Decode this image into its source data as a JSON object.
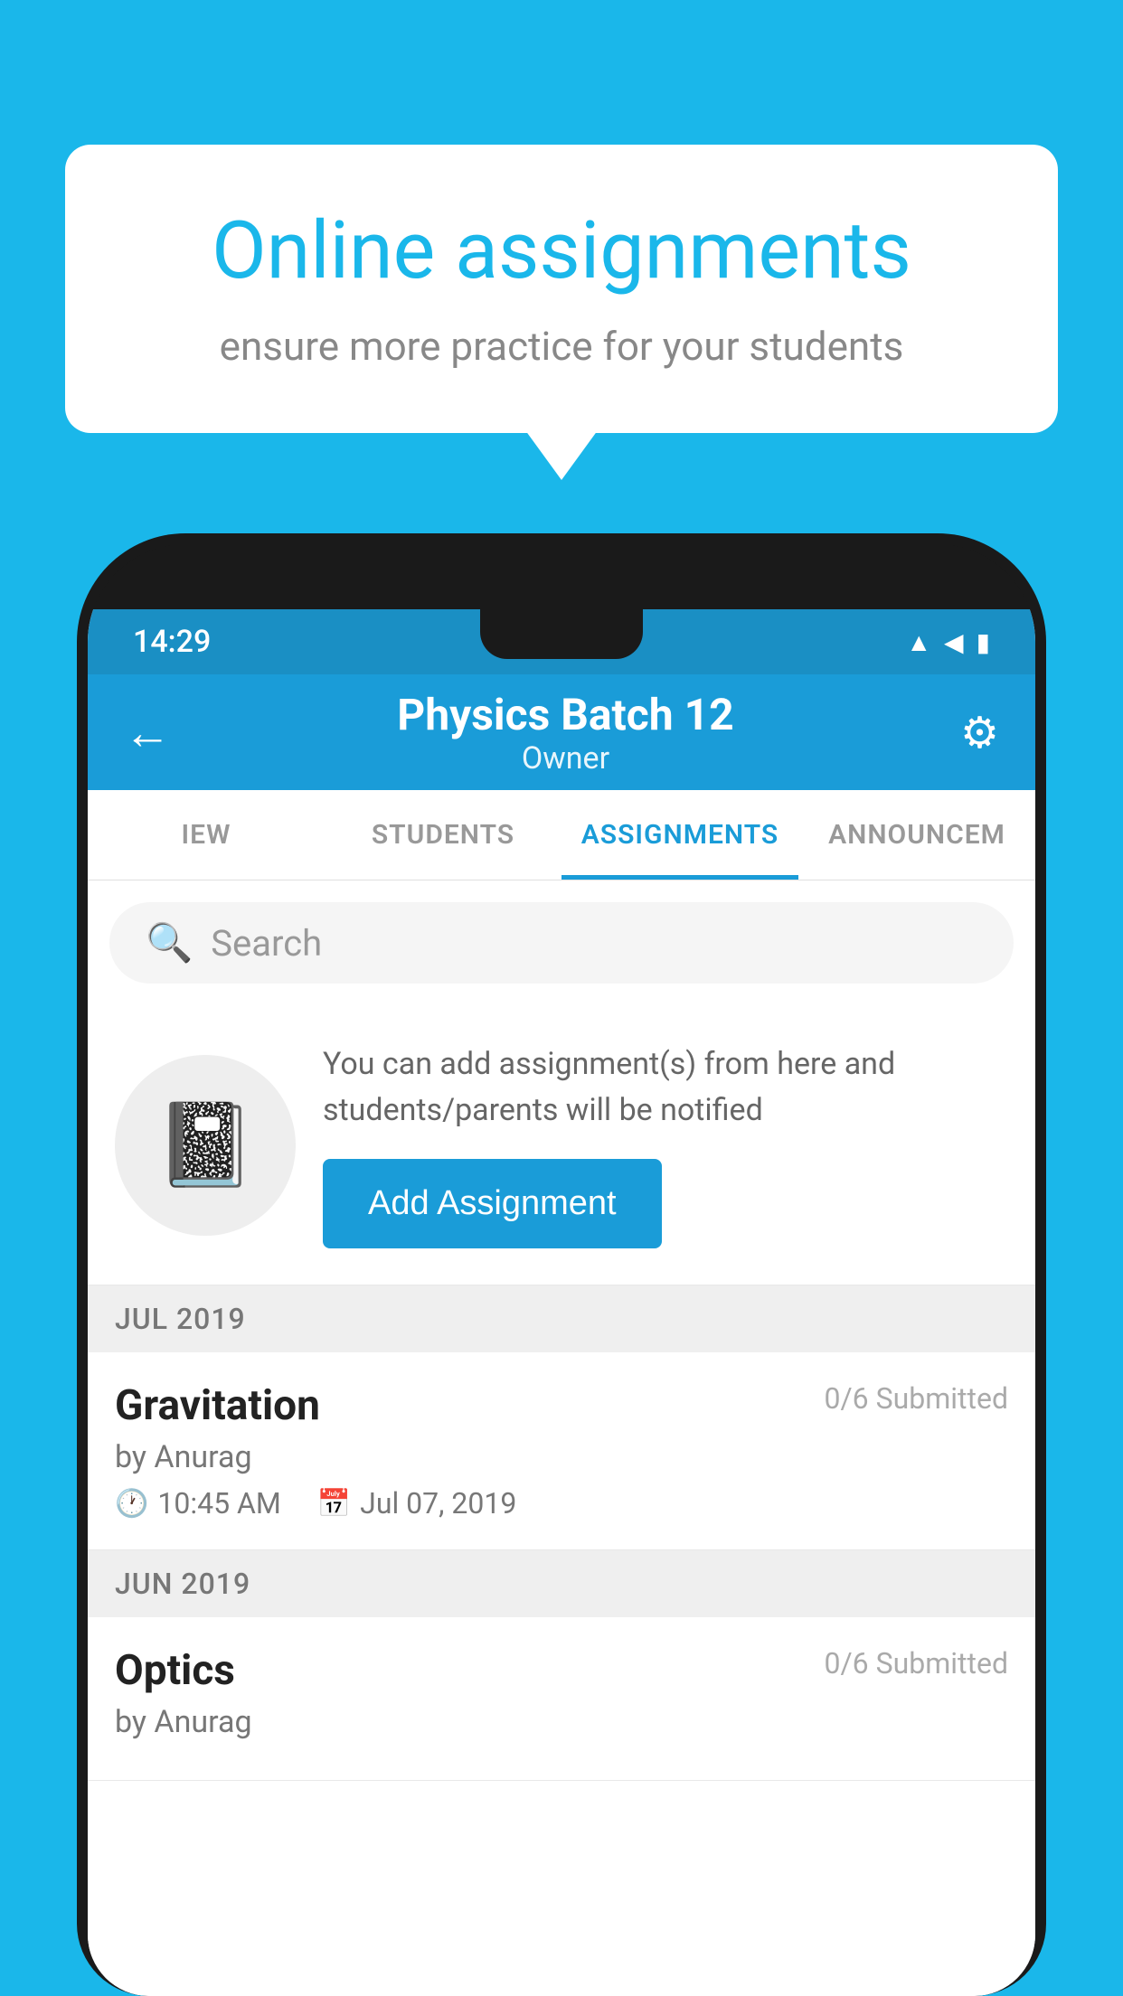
{
  "background_color": "#1ab7ea",
  "speech_bubble": {
    "title": "Online assignments",
    "subtitle": "ensure more practice for your students"
  },
  "phone": {
    "status_bar": {
      "time": "14:29",
      "icons": [
        "wifi",
        "signal",
        "battery"
      ]
    },
    "app_bar": {
      "title": "Physics Batch 12",
      "subtitle": "Owner",
      "back_icon": "←",
      "settings_icon": "⚙"
    },
    "tabs": [
      {
        "label": "IEW",
        "active": false
      },
      {
        "label": "STUDENTS",
        "active": false
      },
      {
        "label": "ASSIGNMENTS",
        "active": true
      },
      {
        "label": "ANNOUNCEM",
        "active": false
      }
    ],
    "search": {
      "placeholder": "Search"
    },
    "add_assignment": {
      "description": "You can add assignment(s) from here and students/parents will be notified",
      "button_label": "Add Assignment"
    },
    "sections": [
      {
        "header": "JUL 2019",
        "assignments": [
          {
            "title": "Gravitation",
            "submitted": "0/6 Submitted",
            "author": "by Anurag",
            "time": "10:45 AM",
            "date": "Jul 07, 2019"
          }
        ]
      },
      {
        "header": "JUN 2019",
        "assignments": [
          {
            "title": "Optics",
            "submitted": "0/6 Submitted",
            "author": "by Anurag",
            "time": "",
            "date": ""
          }
        ]
      }
    ]
  }
}
